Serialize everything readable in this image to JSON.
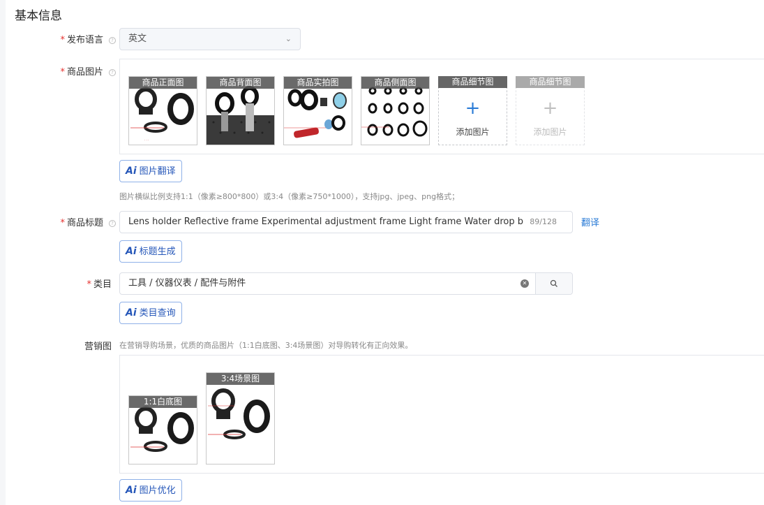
{
  "section_title": "基本信息",
  "language": {
    "label": "发布语言",
    "value": "英文"
  },
  "images": {
    "label": "商品图片",
    "slots": [
      {
        "caption": "商品正面图"
      },
      {
        "caption": "商品背面图"
      },
      {
        "caption": "商品实拍图"
      },
      {
        "caption": "商品侧面图"
      }
    ],
    "add_slots": [
      {
        "caption": "商品细节图",
        "text": "添加图片",
        "plus": "+"
      },
      {
        "caption": "商品细节图",
        "text": "添加图片",
        "plus": "+"
      }
    ],
    "ai_button": "图片翻译",
    "hint": "图片横纵比例支持1:1（像素≥800*800）或3:4（像素≥750*1000），支持jpg、jpeg、png格式；"
  },
  "title": {
    "label": "商品标题",
    "value": "Lens holder Reflective frame Experimental adjustment frame Light frame Water drop bracke",
    "counter": "89/128",
    "translate": "翻译",
    "ai_button": "标题生成"
  },
  "category": {
    "label": "类目",
    "value": "工具 / 仪器仪表 / 配件与附件",
    "ai_button": "类目查询"
  },
  "marketing": {
    "label": "营销图",
    "hint": "在营销导购场景，优质的商品图片（1:1白底图、3:4场景图）对导购转化有正向效果。",
    "slots": [
      {
        "caption": "1:1白底图"
      },
      {
        "caption": "3:4场景图"
      }
    ],
    "ai_button": "图片优化"
  },
  "ai_badge": "Ai",
  "required_mark": "*",
  "colors": {
    "accent": "#2a7bd6",
    "required": "#e5302e",
    "ai_border": "#8fb1e8"
  }
}
